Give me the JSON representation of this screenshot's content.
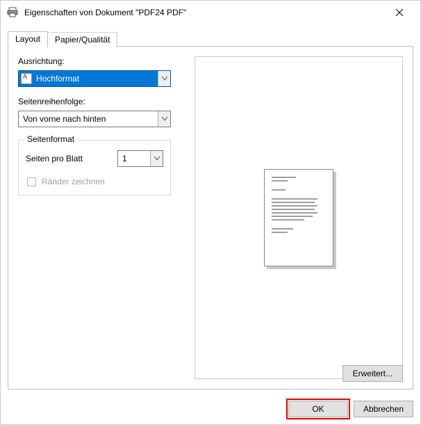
{
  "title": "Eigenschaften von Dokument \"PDF24 PDF\"",
  "tabs": {
    "layout": "Layout",
    "paper": "Papier/Qualität"
  },
  "orientation_label": "Ausrichtung:",
  "orientation_value": "Hochformat",
  "pageorder_label": "Seitenreihenfolge:",
  "pageorder_value": "Von vorne nach hinten",
  "group_legend": "Seitenformat",
  "pages_per_sheet_label": "Seiten pro Blatt",
  "pages_per_sheet_value": "1",
  "draw_borders_label": "Ränder zeichnen",
  "advanced_label": "Erweitert...",
  "ok_label": "OK",
  "cancel_label": "Abbrechen"
}
